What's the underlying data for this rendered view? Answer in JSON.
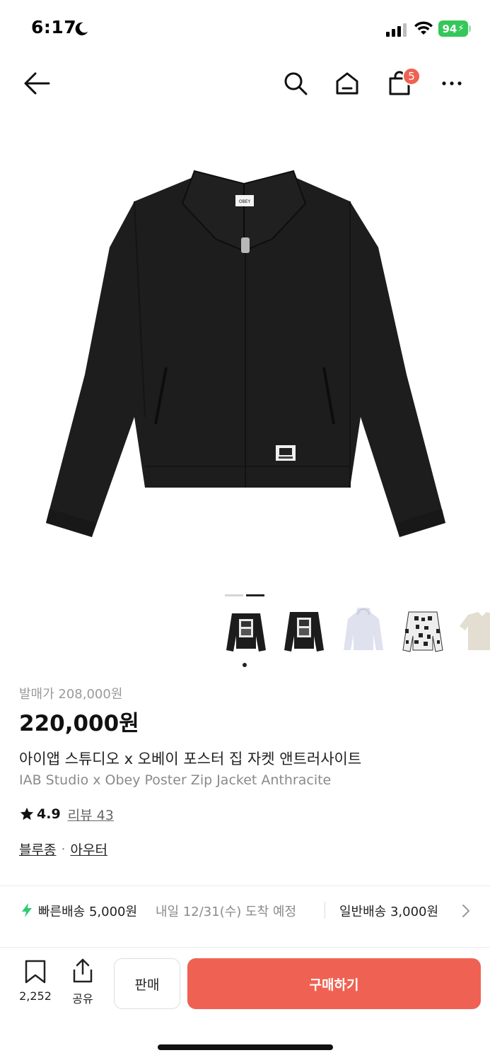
{
  "status_bar": {
    "time": "6:17",
    "battery": "94"
  },
  "nav": {
    "icons": [
      "back-arrow-icon",
      "search-icon",
      "home-icon",
      "shopping-bag-icon",
      "more-icon"
    ],
    "cart_count": "5"
  },
  "gallery": {
    "image": "black-zip-jacket",
    "page_count": 2,
    "active_page": 2
  },
  "thumbnails": [
    {
      "name": "jacket-black-poster-back"
    },
    {
      "name": "jacket-black-poster-back-2"
    },
    {
      "name": "hoodie-lightblue"
    },
    {
      "name": "knit-cardigan-pattern"
    },
    {
      "name": "shirt-beige"
    }
  ],
  "product": {
    "release_price": "발매가 208,000원",
    "price": "220,000원",
    "name_ko": "아이앱 스튜디오 x 오베이 포스터 집 자켓 앤트러사이트",
    "name_en": "IAB Studio x Obey Poster Zip Jacket Anthracite",
    "rating": "4.9",
    "review_label": "리뷰 43",
    "category_1": "블루종",
    "category_sep": "·",
    "category_2": "아우터"
  },
  "shipping": {
    "fast_label": "빠른배송 5,000원",
    "fast_date": "내일 12/31(수) 도착 예정",
    "normal_label": "일반배송 3,000원"
  },
  "bottom_bar": {
    "bookmark_count": "2,252",
    "share_label": "공유",
    "sell_label": "판매",
    "buy_label": "구매하기"
  },
  "colors": {
    "accent": "#ef6253",
    "fast_ship": "#2ecc71",
    "battery": "#34c759"
  }
}
